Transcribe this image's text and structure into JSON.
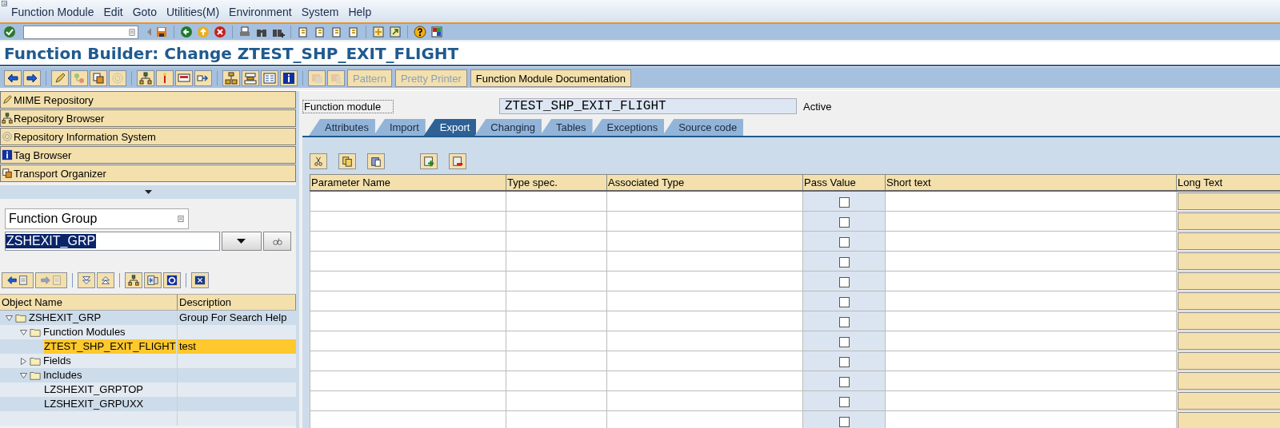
{
  "menu_bar": {
    "items": [
      "Function Module",
      "Edit",
      "Goto",
      "Utilities(M)",
      "Environment",
      "System",
      "Help"
    ]
  },
  "title": "Function Builder: Change ZTEST_SHP_EXIT_FLIGHT",
  "application_toolbar": {
    "icon_buttons": [
      {
        "disabled": false
      },
      {
        "disabled": false
      },
      {
        "disabled": false
      },
      {
        "disabled": true
      },
      {
        "disabled": false
      },
      {
        "disabled": true
      },
      {
        "disabled": false
      },
      {
        "disabled": false
      },
      {
        "disabled": false
      },
      {
        "disabled": false
      },
      {
        "disabled": false
      },
      {
        "disabled": false
      },
      {
        "disabled": false
      },
      {
        "disabled": false
      },
      {
        "disabled": true
      },
      {
        "disabled": true
      }
    ],
    "buttons": [
      {
        "label": "Pattern",
        "disabled": true
      },
      {
        "label": "Pretty Printer",
        "disabled": true
      },
      {
        "label": "Function Module Documentation",
        "disabled": false
      }
    ]
  },
  "navigation": {
    "items": [
      "MIME Repository",
      "Repository Browser",
      "Repository Information System",
      "Tag Browser",
      "Transport Organizer"
    ]
  },
  "object_selection": {
    "type": {
      "value": "Function Group"
    },
    "name": {
      "value": "ZSHEXIT_GRP",
      "selected": true
    }
  },
  "object_tree": {
    "columns": [
      "Object Name",
      "Description"
    ],
    "nodes": [
      {
        "name": "ZSHEXIT_GRP",
        "description": "Group For Search Help",
        "kind": "folder",
        "expanded": true,
        "selected": false,
        "children": [
          {
            "name": "Function Modules",
            "kind": "folder",
            "expanded": true,
            "selected": false,
            "children": [
              {
                "name": "ZTEST_SHP_EXIT_FLIGHT",
                "description": "test",
                "selected": true
              }
            ]
          },
          {
            "name": "Fields",
            "kind": "folder",
            "expanded": false,
            "selected": false
          },
          {
            "name": "Includes",
            "kind": "folder",
            "expanded": true,
            "selected": false,
            "children": [
              {
                "name": "LZSHEXIT_GRPTOP",
                "selected": false
              },
              {
                "name": "LZSHEXIT_GRPUXX",
                "selected": false
              }
            ]
          }
        ]
      }
    ]
  },
  "function_module": {
    "label": "Function module",
    "value": "ZTEST_SHP_EXIT_FLIGHT",
    "status": "Active"
  },
  "tabs": [
    {
      "label": "Attributes",
      "selected": false
    },
    {
      "label": "Import",
      "selected": false
    },
    {
      "label": "Export",
      "selected": true
    },
    {
      "label": "Changing",
      "selected": false
    },
    {
      "label": "Tables",
      "selected": false
    },
    {
      "label": "Exceptions",
      "selected": false
    },
    {
      "label": "Source code",
      "selected": false
    }
  ],
  "parameters": {
    "columns": [
      "Parameter Name",
      "Type spec.",
      "Associated Type",
      "Pass Value",
      "Short text",
      "Long Text"
    ],
    "rows": [
      {
        "pass_value": false
      },
      {
        "pass_value": false
      },
      {
        "pass_value": false
      },
      {
        "pass_value": false
      },
      {
        "pass_value": false
      },
      {
        "pass_value": false
      },
      {
        "pass_value": false
      },
      {
        "pass_value": false
      },
      {
        "pass_value": false
      },
      {
        "pass_value": false
      },
      {
        "pass_value": false
      },
      {
        "pass_value": false
      }
    ]
  }
}
